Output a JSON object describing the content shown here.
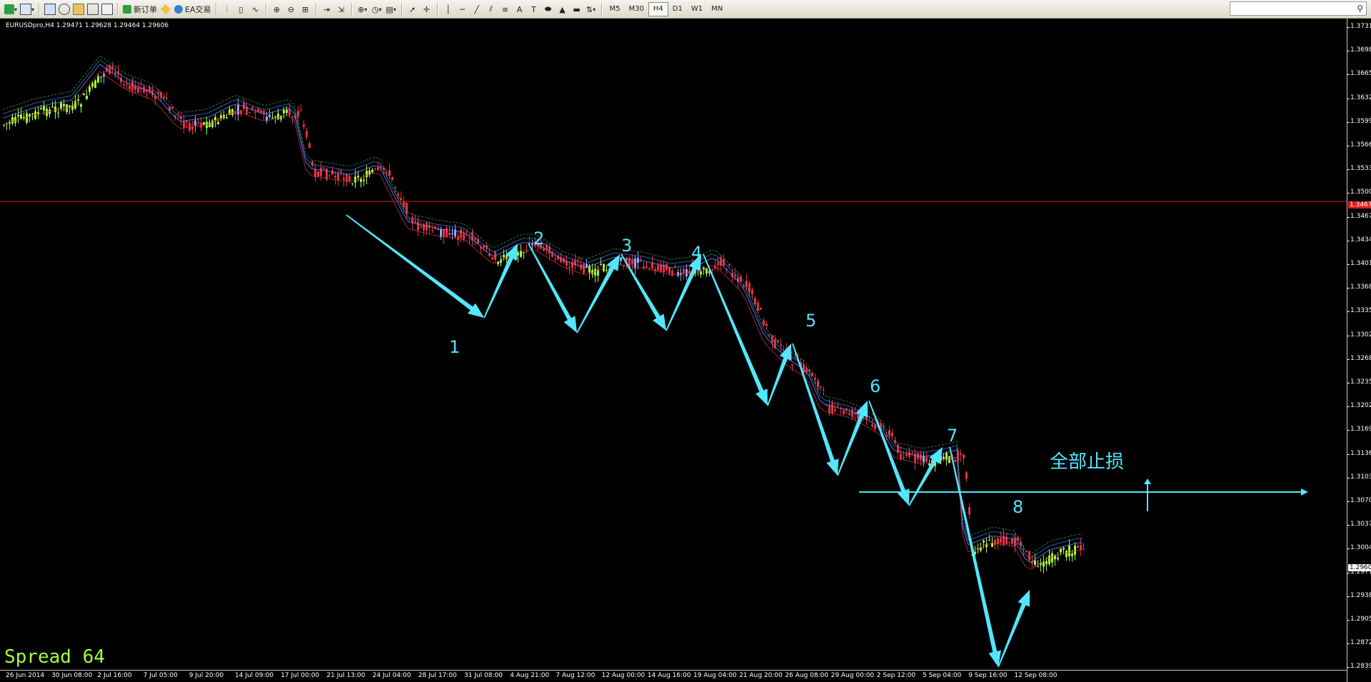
{
  "toolbar": {
    "new_order_label": "新订单",
    "ea_label": "EA交易",
    "timeframes": [
      "M5",
      "M30",
      "H4",
      "D1",
      "W1",
      "MN"
    ],
    "active_timeframe": "H4"
  },
  "chart": {
    "title": "EURUSDpro,H4  1.29471 1.29628 1.29464 1.29606",
    "price_ticks": [
      "1.37310",
      "1.36980",
      "1.36650",
      "1.36320",
      "1.35990",
      "1.35660",
      "1.35330",
      "1.35000",
      "1.34670",
      "1.34340",
      "1.34010",
      "1.33680",
      "1.33350",
      "1.33020",
      "1.32685",
      "1.32355",
      "1.32025",
      "1.31695",
      "1.31365",
      "1.31035",
      "1.30705",
      "1.30375",
      "1.30045",
      "1.29715",
      "1.29385",
      "1.29055",
      "1.28725",
      "1.28395"
    ],
    "time_ticks": [
      "26 Jun 2014",
      "30 Jun 08:00",
      "2 Jul 16:00",
      "7 Jul 05:00",
      "9 Jul 20:00",
      "14 Jul 09:00",
      "17 Jul 00:00",
      "21 Jul 13:00",
      "24 Jul 04:00",
      "28 Jul 17:00",
      "31 Jul 08:00",
      "4 Aug 21:00",
      "7 Aug 12:00",
      "12 Aug 00:00",
      "14 Aug 16:00",
      "19 Aug 04:00",
      "21 Aug 20:00",
      "26 Aug 08:00",
      "29 Aug 00:00",
      "2 Sep 12:00",
      "5 Sep 04:00",
      "9 Sep 16:00",
      "12 Sep 08:00"
    ],
    "current_price": "1.29606",
    "red_line_price": "1.34670",
    "spread_text": "Spread 64",
    "wave_labels": [
      "1",
      "2",
      "3",
      "4",
      "5",
      "6",
      "7",
      "8"
    ],
    "stop_label": "全部止损"
  },
  "colors": {
    "bull": "#a6ff3a",
    "bear": "#e8303a",
    "neutral": "#8fa8ff",
    "annotation": "#52e6ff",
    "hline": "#e21b1b"
  }
}
